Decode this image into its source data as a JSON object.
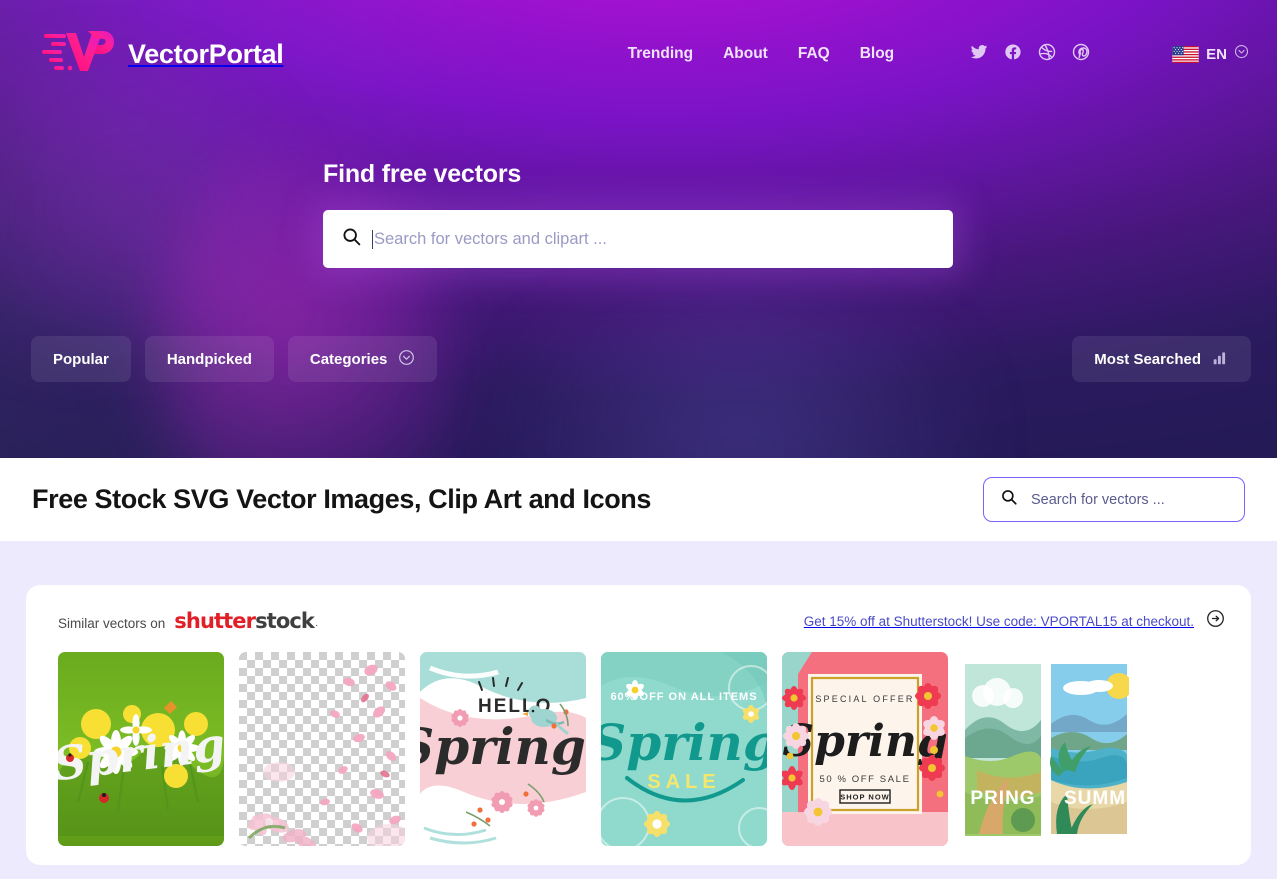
{
  "brand": {
    "name": "VectorPortal",
    "logo_icon": "vp-monogram-icon"
  },
  "nav": {
    "links": [
      {
        "label": "Trending"
      },
      {
        "label": "About"
      },
      {
        "label": "FAQ"
      },
      {
        "label": "Blog"
      }
    ],
    "socials": [
      {
        "name": "twitter-icon"
      },
      {
        "name": "facebook-icon"
      },
      {
        "name": "dribbble-icon"
      },
      {
        "name": "pinterest-icon"
      }
    ],
    "language": {
      "code": "EN",
      "flag": "us-flag-icon",
      "chevron": "chevron-down-icon"
    }
  },
  "hero": {
    "title": "Find free vectors",
    "search": {
      "placeholder": "Search for vectors and clipart ...",
      "value": "",
      "icon": "search-icon"
    },
    "filters": [
      {
        "label": "Popular",
        "icon": null
      },
      {
        "label": "Handpicked",
        "icon": null
      },
      {
        "label": "Categories",
        "icon": "chevron-down-circle-icon"
      }
    ],
    "most_searched": {
      "label": "Most Searched",
      "icon": "bar-chart-icon"
    }
  },
  "page": {
    "title": "Free Stock SVG Vector Images, Clip Art and Icons",
    "search": {
      "placeholder": "Search for vectors ...",
      "value": "",
      "icon": "search-icon"
    }
  },
  "promo": {
    "label": "Similar vectors on",
    "partner": {
      "word_red": "shutter",
      "word_dark": "stock",
      "trademark": "·"
    },
    "offer_text": "Get 15% off at Shutterstock! Use code: VPORTAL15 at checkout.",
    "offer_icon": "arrow-right-circle-icon",
    "thumbnails": [
      {
        "name": "spring-dandelions-daisies",
        "caption": "Spring"
      },
      {
        "name": "pink-petals-transparent",
        "caption": ""
      },
      {
        "name": "hello-spring-bird",
        "caption": "HELLO Spring"
      },
      {
        "name": "spring-sale-mint",
        "caption": "60% OFF ON ALL ITEMS Spring SALE"
      },
      {
        "name": "spring-special-offer-frame",
        "caption": "SPECIAL OFFER Spring 50 % OFF SALE SHOP NOW"
      },
      {
        "name": "seasons-landscape-panels",
        "caption": "PRING SUMM"
      }
    ]
  },
  "colors": {
    "hero_purple": "#9d12cf",
    "hero_navy": "#231a55",
    "accent_pink": "#ff1a8c",
    "page_bg": "#eceafc",
    "link_purple": "#4a4ac8",
    "border_purple": "#7b61ff",
    "shutterstock_red": "#e01f26"
  }
}
